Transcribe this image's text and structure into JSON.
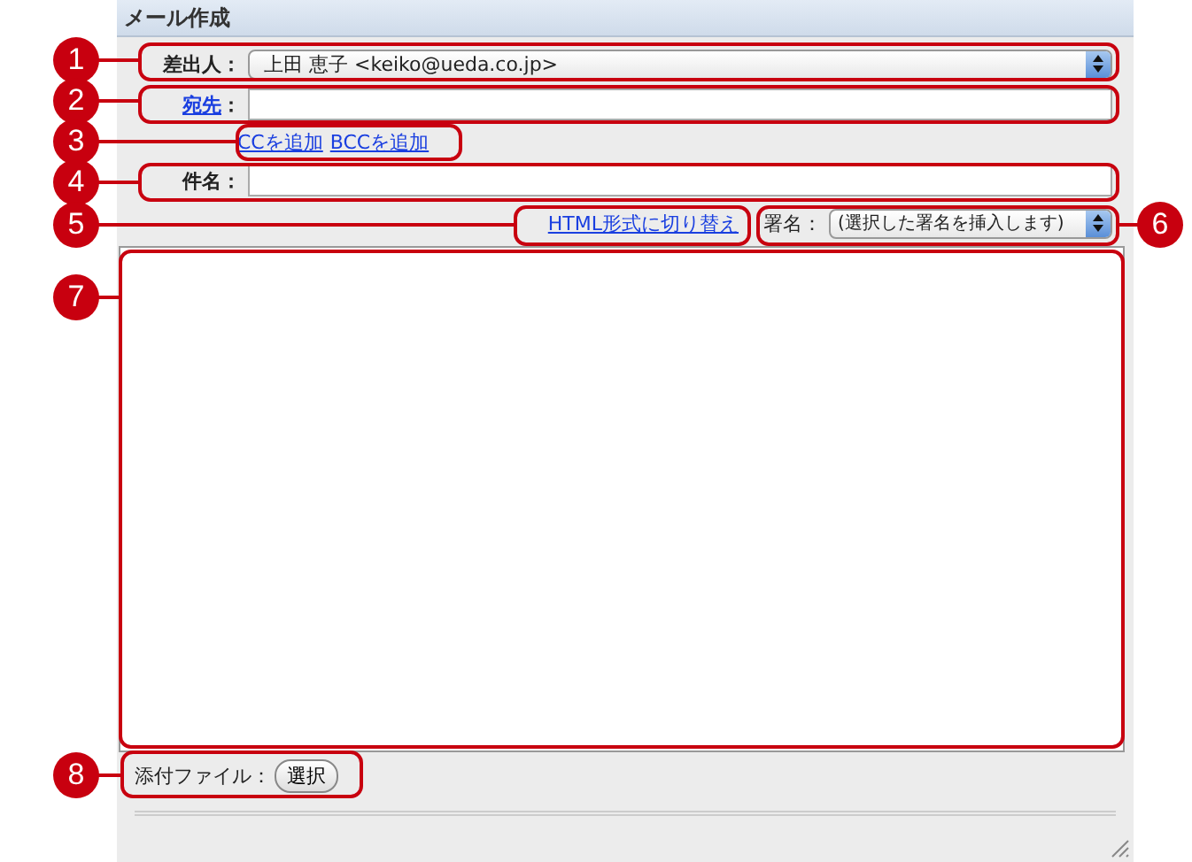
{
  "window": {
    "title": "メール作成"
  },
  "form": {
    "from_label": "差出人：",
    "from_value": "上田 恵子 <keiko@ueda.co.jp>",
    "to_label": "宛先",
    "to_colon": "：",
    "cc_link": "CCを追加",
    "bcc_link": "BCCを追加",
    "subject_label": "件名：",
    "html_link": "HTML形式に切り替え",
    "signature_label": "署名：",
    "signature_value": "(選択した署名を挿入します)",
    "attach_label": "添付ファイル：",
    "attach_button": "選択"
  },
  "callouts": [
    {
      "number": "1"
    },
    {
      "number": "2"
    },
    {
      "number": "3"
    },
    {
      "number": "4"
    },
    {
      "number": "5"
    },
    {
      "number": "6"
    },
    {
      "number": "7"
    },
    {
      "number": "8"
    }
  ]
}
